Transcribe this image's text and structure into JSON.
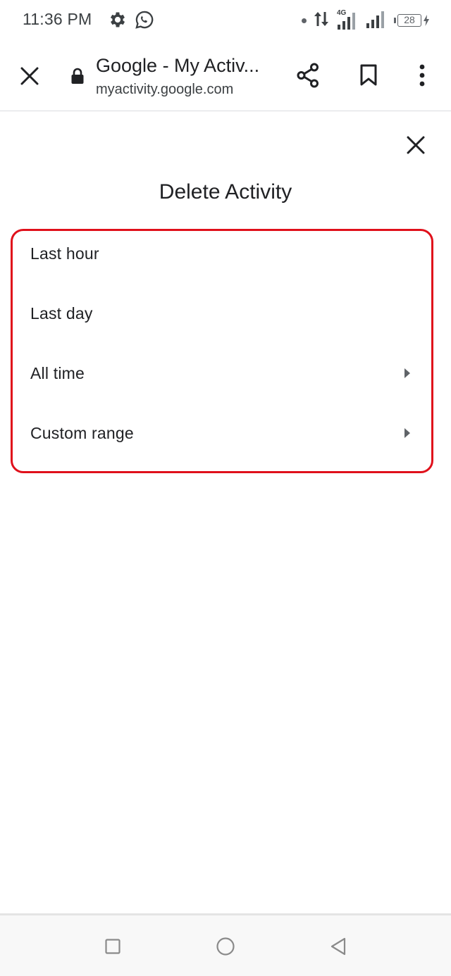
{
  "status_bar": {
    "time": "11:36 PM",
    "left_icons": [
      "gear-icon",
      "whatsapp-icon"
    ],
    "network_label": "4G",
    "battery_level": "28"
  },
  "toolbar": {
    "page_title": "Google - My Activ...",
    "url": "myactivity.google.com"
  },
  "dialog": {
    "title": "Delete Activity",
    "options": [
      {
        "label": "Last hour",
        "has_submenu": false
      },
      {
        "label": "Last day",
        "has_submenu": false
      },
      {
        "label": "All time",
        "has_submenu": true
      },
      {
        "label": "Custom range",
        "has_submenu": true
      }
    ],
    "highlight_color": "#e0101b"
  },
  "nav_bar": {
    "buttons": [
      "recents-icon",
      "home-icon",
      "back-icon"
    ]
  }
}
